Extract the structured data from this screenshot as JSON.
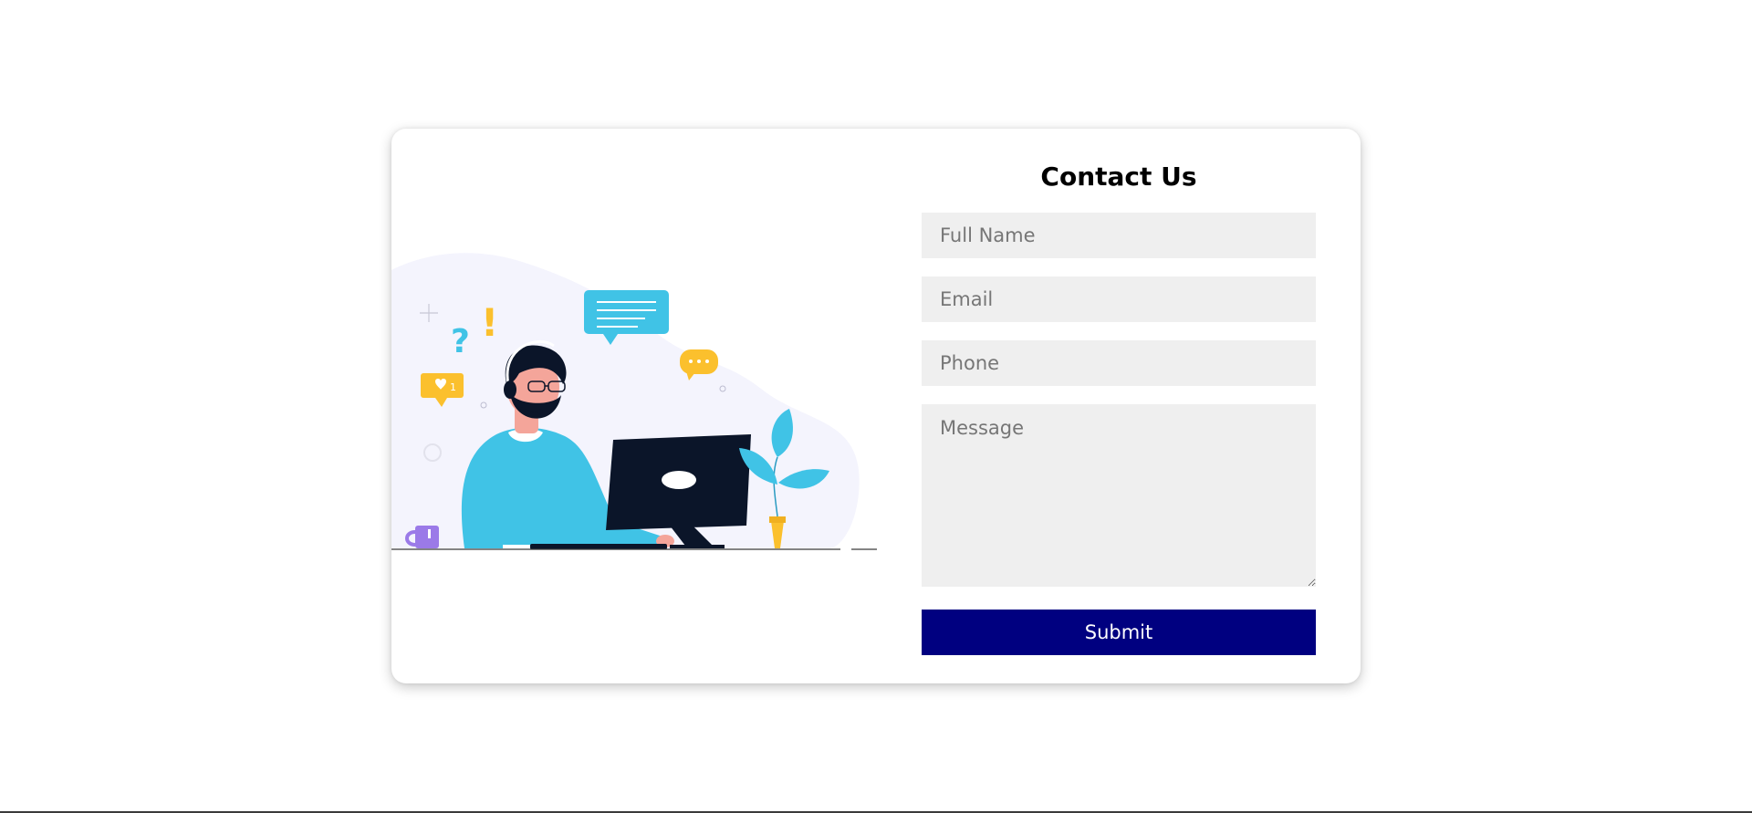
{
  "contact_form": {
    "title": "Contact Us",
    "fields": {
      "full_name": {
        "placeholder": "Full Name",
        "value": ""
      },
      "email": {
        "placeholder": "Email",
        "value": ""
      },
      "phone": {
        "placeholder": "Phone",
        "value": ""
      },
      "message": {
        "placeholder": "Message",
        "value": ""
      }
    },
    "submit_label": "Submit",
    "accent_color": "#000080"
  },
  "illustration": {
    "subject": "customer-support-agent-at-computer",
    "like_badge_count": "1",
    "colors": {
      "blob": "#f4f4fd",
      "shirt": "#40c3e6",
      "monitor": "#0b1529",
      "speech_bubble": "#40c3e6",
      "accent_yellow": "#fbc02d",
      "mug": "#9b7ae8"
    }
  }
}
